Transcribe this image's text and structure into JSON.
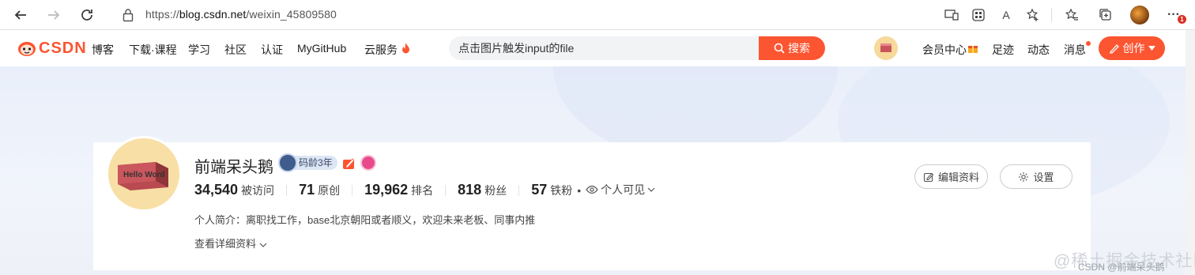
{
  "browser": {
    "url_prefix": "https://",
    "url_host": "blog.csdn.net",
    "url_path": "/weixin_45809580",
    "notification_count": "1",
    "read_aloud_label": "A"
  },
  "nav": {
    "logo": "CSDN",
    "items": [
      "博客",
      "下载·课程",
      "学习",
      "社区",
      "认证",
      "MyGitHub",
      "云服务"
    ],
    "search_value": "点击图片触发input的file",
    "search_button": "搜索",
    "right_items": [
      "会员中心",
      "足迹",
      "动态",
      "消息"
    ],
    "create_button": "创作"
  },
  "profile": {
    "name": "前端呆头鹅",
    "code_age": "码龄3年",
    "stats": [
      {
        "num": "34,540",
        "label": "被访问"
      },
      {
        "num": "71",
        "label": "原创"
      },
      {
        "num": "19,962",
        "label": "排名"
      },
      {
        "num": "818",
        "label": "粉丝"
      },
      {
        "num": "57",
        "label": "铁粉"
      }
    ],
    "visibility": "个人可见",
    "bio": "个人简介：离职找工作，base北京朝阳或者顺义，欢迎未来老板、同事内推",
    "detail_link": "查看详细资料",
    "edit_button": "编辑资料",
    "settings_button": "设置",
    "avatar_text": "Hello Word"
  },
  "watermark": {
    "main": "@稀土掘金技术社区",
    "sub": "CSDN @前端呆头鹅"
  },
  "colors": {
    "accent": "#fc5531",
    "bg": "#eef2f9"
  }
}
